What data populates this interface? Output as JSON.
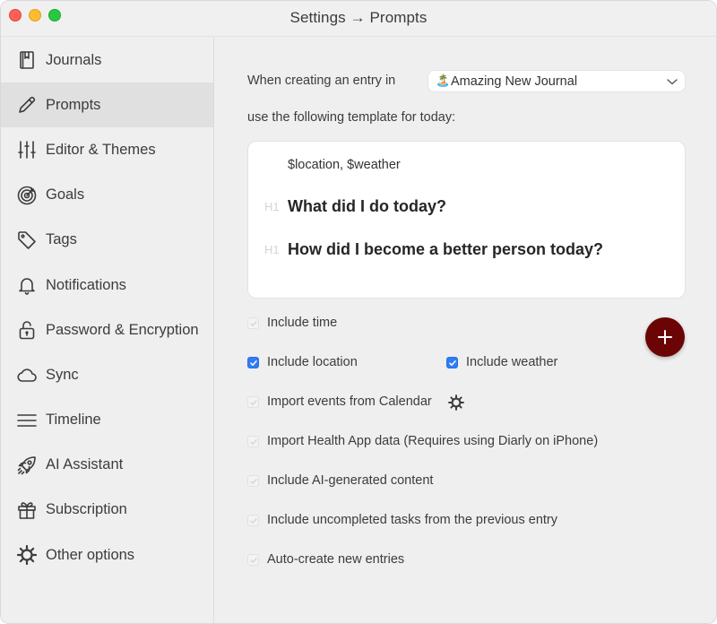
{
  "window": {
    "title": "Settings → Prompts"
  },
  "sidebar": {
    "items": [
      {
        "label": "Journals",
        "icon": "journal-icon",
        "active": false
      },
      {
        "label": "Prompts",
        "icon": "pencil-icon",
        "active": true
      },
      {
        "label": "Editor & Themes",
        "icon": "sliders-icon",
        "active": false
      },
      {
        "label": "Goals",
        "icon": "target-icon",
        "active": false
      },
      {
        "label": "Tags",
        "icon": "tag-icon",
        "active": false
      },
      {
        "label": "Notifications",
        "icon": "bell-icon",
        "active": false
      },
      {
        "label": "Password & Encryption",
        "icon": "lock-icon",
        "active": false
      },
      {
        "label": "Sync",
        "icon": "cloud-icon",
        "active": false
      },
      {
        "label": "Timeline",
        "icon": "lines-icon",
        "active": false
      },
      {
        "label": "AI Assistant",
        "icon": "rocket-icon",
        "active": false
      },
      {
        "label": "Subscription",
        "icon": "gift-icon",
        "active": false
      },
      {
        "label": "Other options",
        "icon": "gear-icon",
        "active": false
      }
    ]
  },
  "main": {
    "when_creating_label": "When creating an entry in",
    "journal_select": {
      "emoji": "🏝️",
      "value": "Amazing New Journal"
    },
    "template_label": "use the following template for today:",
    "template": {
      "meta_line": "$location, $weather",
      "heading_marker": "H1",
      "headings": [
        "What did I do today?",
        "How did I become a better person today?"
      ]
    },
    "options": [
      {
        "label": "Include time",
        "checked": true,
        "enabled": false
      },
      {
        "label": "Include location",
        "checked": true,
        "enabled": true
      },
      {
        "label": "Include weather",
        "checked": true,
        "enabled": true
      },
      {
        "label": "Import events from Calendar",
        "checked": true,
        "enabled": false
      },
      {
        "label": "Import Health App data (Requires using Diarly on iPhone)",
        "checked": true,
        "enabled": false
      },
      {
        "label": "Include AI-generated content",
        "checked": true,
        "enabled": false
      },
      {
        "label": "Include uncompleted tasks from the previous entry",
        "checked": true,
        "enabled": false
      },
      {
        "label": "Auto-create new entries",
        "checked": true,
        "enabled": false
      }
    ],
    "add_button_icon": "plus-icon"
  },
  "colors": {
    "accent_checkbox": "#2f7cf6",
    "fab_background": "#6b0505",
    "sidebar_active": "#e0e0e0",
    "window_background": "#efefef"
  }
}
